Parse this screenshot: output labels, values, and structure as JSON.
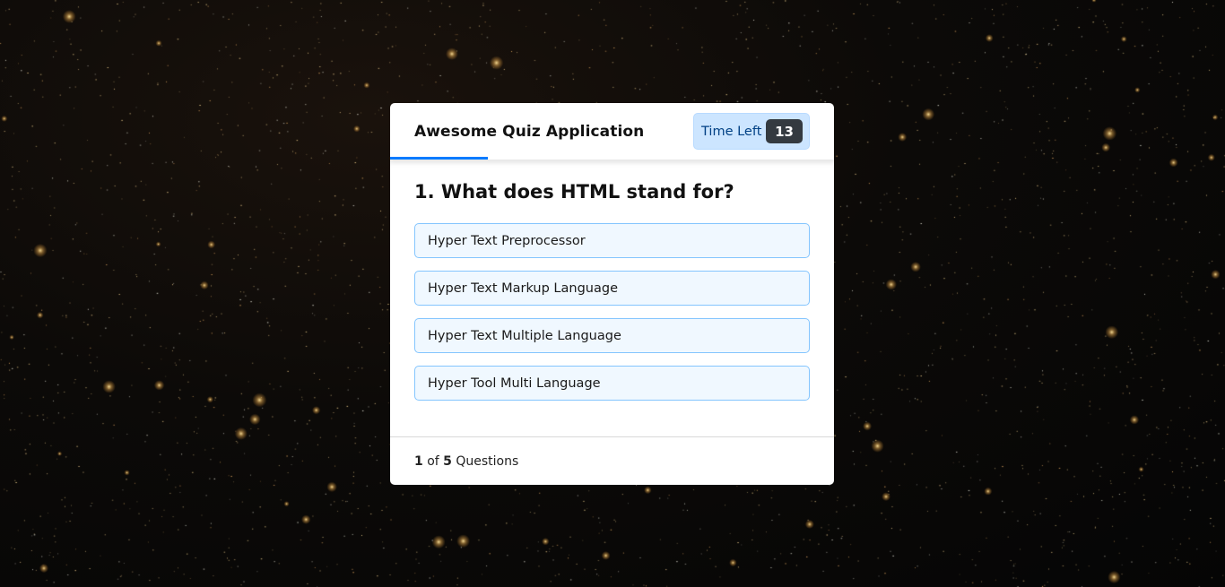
{
  "quiz": {
    "title": "Awesome Quiz Application",
    "timer": {
      "label": "Time Left",
      "seconds": "13",
      "progress_fraction": 0.22
    },
    "question": {
      "text": "1. What does HTML stand for?",
      "options": [
        "Hyper Text Preprocessor",
        "Hyper Text Markup Language",
        "Hyper Text Multiple Language",
        "Hyper Tool Multi Language"
      ]
    },
    "footer": {
      "current": "1",
      "of_label": "of",
      "total": "5",
      "questions_label": "Questions"
    }
  },
  "colors": {
    "accent": "#007bff",
    "timer_bg": "#cce5ff",
    "timer_text": "#004085",
    "timer_badge": "#343a40",
    "option_bg": "#f0f8ff",
    "option_border": "#84c5fe"
  }
}
